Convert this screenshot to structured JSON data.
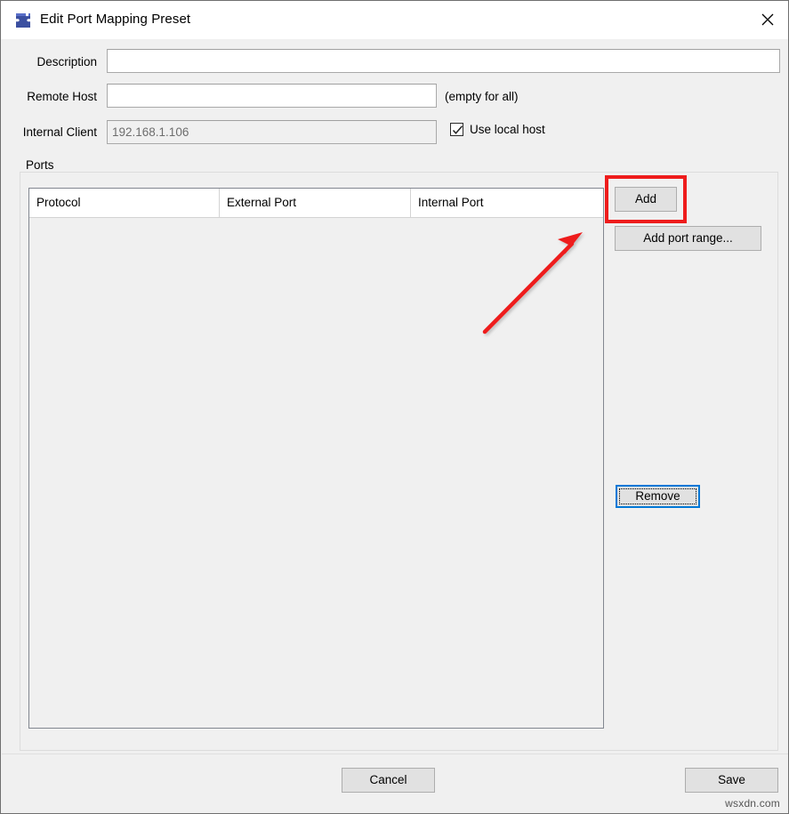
{
  "window": {
    "title": "Edit Port Mapping Preset",
    "icon": "puzzle-piece-icon",
    "close_label": "✕",
    "accent_highlight_color": "#ee1c1c",
    "focus_color": "#0078d7"
  },
  "form": {
    "description": {
      "label": "Description",
      "value": "",
      "placeholder": ""
    },
    "remote_host": {
      "label": "Remote Host",
      "value": "",
      "placeholder": "",
      "hint": "(empty for all)"
    },
    "internal_client": {
      "label": "Internal Client",
      "value": "192.168.1.106",
      "readonly": true
    },
    "use_local_host": {
      "label": "Use local host",
      "checked": true
    }
  },
  "ports": {
    "group_label": "Ports",
    "columns": [
      "Protocol",
      "External Port",
      "Internal Port"
    ],
    "rows": [],
    "buttons": {
      "add": "Add",
      "add_port_range": "Add port range...",
      "remove": "Remove"
    }
  },
  "footer": {
    "cancel": "Cancel",
    "save": "Save"
  },
  "watermark": "wsxdn.com"
}
